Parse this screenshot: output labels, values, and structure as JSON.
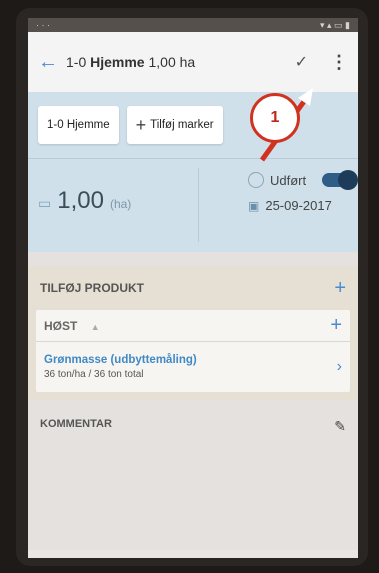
{
  "appbar": {
    "title_prefix": "1-0",
    "title_bold": "Hjemme",
    "title_suffix": "1,00 ha"
  },
  "chips": {
    "field": "1-0 Hjemme",
    "add_marker": "Tilføj marker"
  },
  "area": {
    "value": "1,00",
    "unit": "(ha)"
  },
  "status": {
    "label": "Udført",
    "toggle_on": true,
    "date": "25-09-2017"
  },
  "products": {
    "header": "TILFØJ PRODUKT",
    "group": "HØST",
    "item_name": "Grønmasse (udbyttemåling)",
    "item_sub": "36 ton/ha / 36 ton total"
  },
  "comment": {
    "label": "KOMMENTAR"
  },
  "annotation": {
    "number": "1",
    "color": "#d0321f"
  },
  "icons": {
    "back": "arrow-left-icon",
    "confirm": "check-icon",
    "more": "more-vert-icon",
    "add": "plus-icon",
    "clock": "clock-icon",
    "calendar": "calendar-icon",
    "edit": "pencil-icon"
  }
}
